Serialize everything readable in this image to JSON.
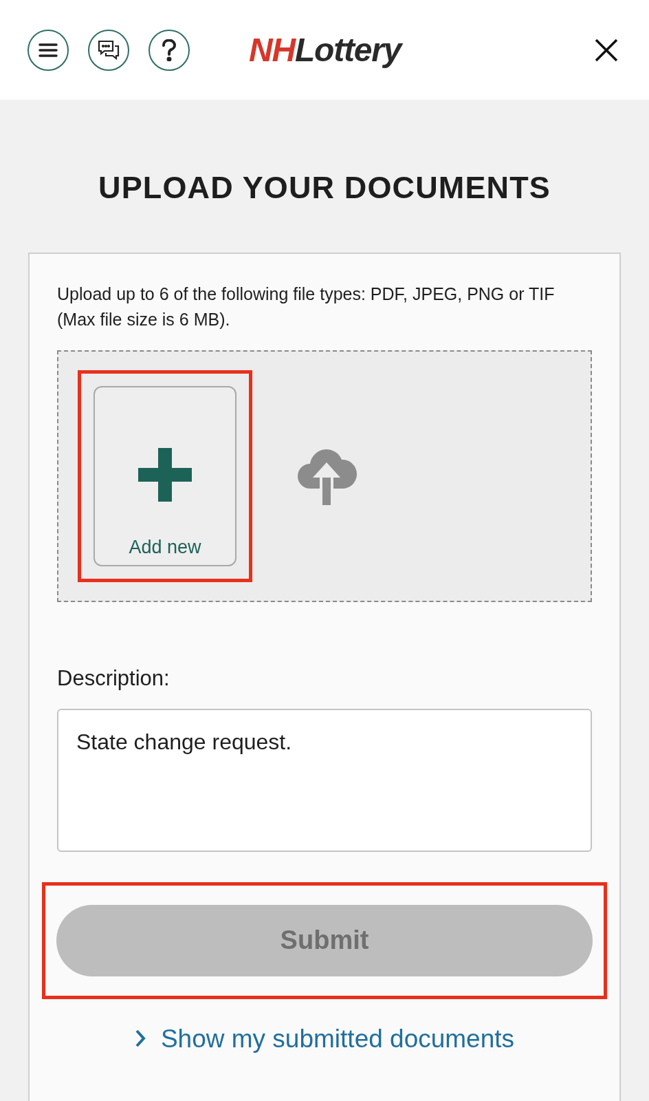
{
  "header": {
    "logo": {
      "part_1": "NH",
      "part_2": "Lottery"
    }
  },
  "title": "UPLOAD YOUR DOCUMENTS",
  "upload": {
    "instructions": "Upload up to 6 of the following file types: PDF, JPEG, PNG or TIF (Max file size is 6 MB).",
    "add_new": {
      "label": "Add new",
      "highlighted": true
    }
  },
  "description": {
    "label": "Description:",
    "value": "State change request."
  },
  "submit": {
    "label": "Submit",
    "disabled": true,
    "highlighted": true
  },
  "link": {
    "label": "Show my submitted documents"
  }
}
